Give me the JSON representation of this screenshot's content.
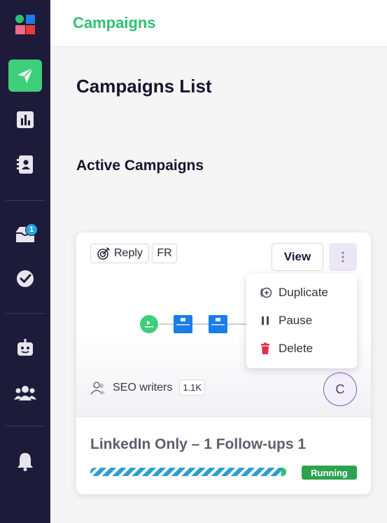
{
  "header": {
    "title": "Campaigns"
  },
  "page": {
    "title": "Campaigns List",
    "section_title": "Active Campaigns"
  },
  "sidebar": {
    "inbox_badge": "1",
    "items": [
      "logo",
      "campaigns",
      "analytics",
      "contacts",
      "inbox",
      "tasks",
      "bot",
      "team",
      "notifications"
    ]
  },
  "card": {
    "reply_label": "Reply",
    "language": "FR",
    "view_label": "View",
    "flow_nodes": [
      "start",
      "LinkedIn visit profile",
      "LinkedIn send invitation"
    ],
    "audience_name": "SEO writers",
    "audience_count": "1.1K",
    "avatar_initial": "C",
    "campaign_name": "LinkedIn Only – 1 Follow-ups 1",
    "status": "Running",
    "progress": 1.0
  },
  "menu": {
    "duplicate": "Duplicate",
    "pause": "Pause",
    "delete": "Delete"
  },
  "colors": {
    "accent": "#2ec270",
    "sidebar": "#1e1b3a",
    "running": "#2ca34e",
    "node_blue": "#1a7ee8",
    "delete_red": "#d9334a"
  }
}
